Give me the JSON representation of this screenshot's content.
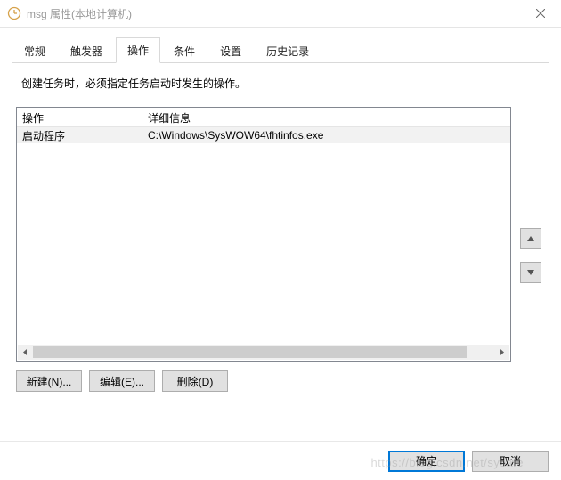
{
  "window": {
    "title": "msg 属性(本地计算机)"
  },
  "tabs": [
    {
      "label": "常规",
      "active": false
    },
    {
      "label": "触发器",
      "active": false
    },
    {
      "label": "操作",
      "active": true
    },
    {
      "label": "条件",
      "active": false
    },
    {
      "label": "设置",
      "active": false
    },
    {
      "label": "历史记录",
      "active": false
    }
  ],
  "instruction": "创建任务时，必须指定任务启动时发生的操作。",
  "list": {
    "columns": {
      "action": "操作",
      "details": "详细信息"
    },
    "rows": [
      {
        "action": "启动程序",
        "details": "C:\\Windows\\SysWOW64\\fhtinfos.exe"
      }
    ]
  },
  "sideButtons": {
    "up": "▲",
    "down": "▼"
  },
  "actionButtons": {
    "new": "新建(N)...",
    "edit": "编辑(E)...",
    "delete": "删除(D)"
  },
  "footer": {
    "ok": "确定",
    "cancel": "取消"
  },
  "watermark": "https://blog.csdn.net/sysafe"
}
